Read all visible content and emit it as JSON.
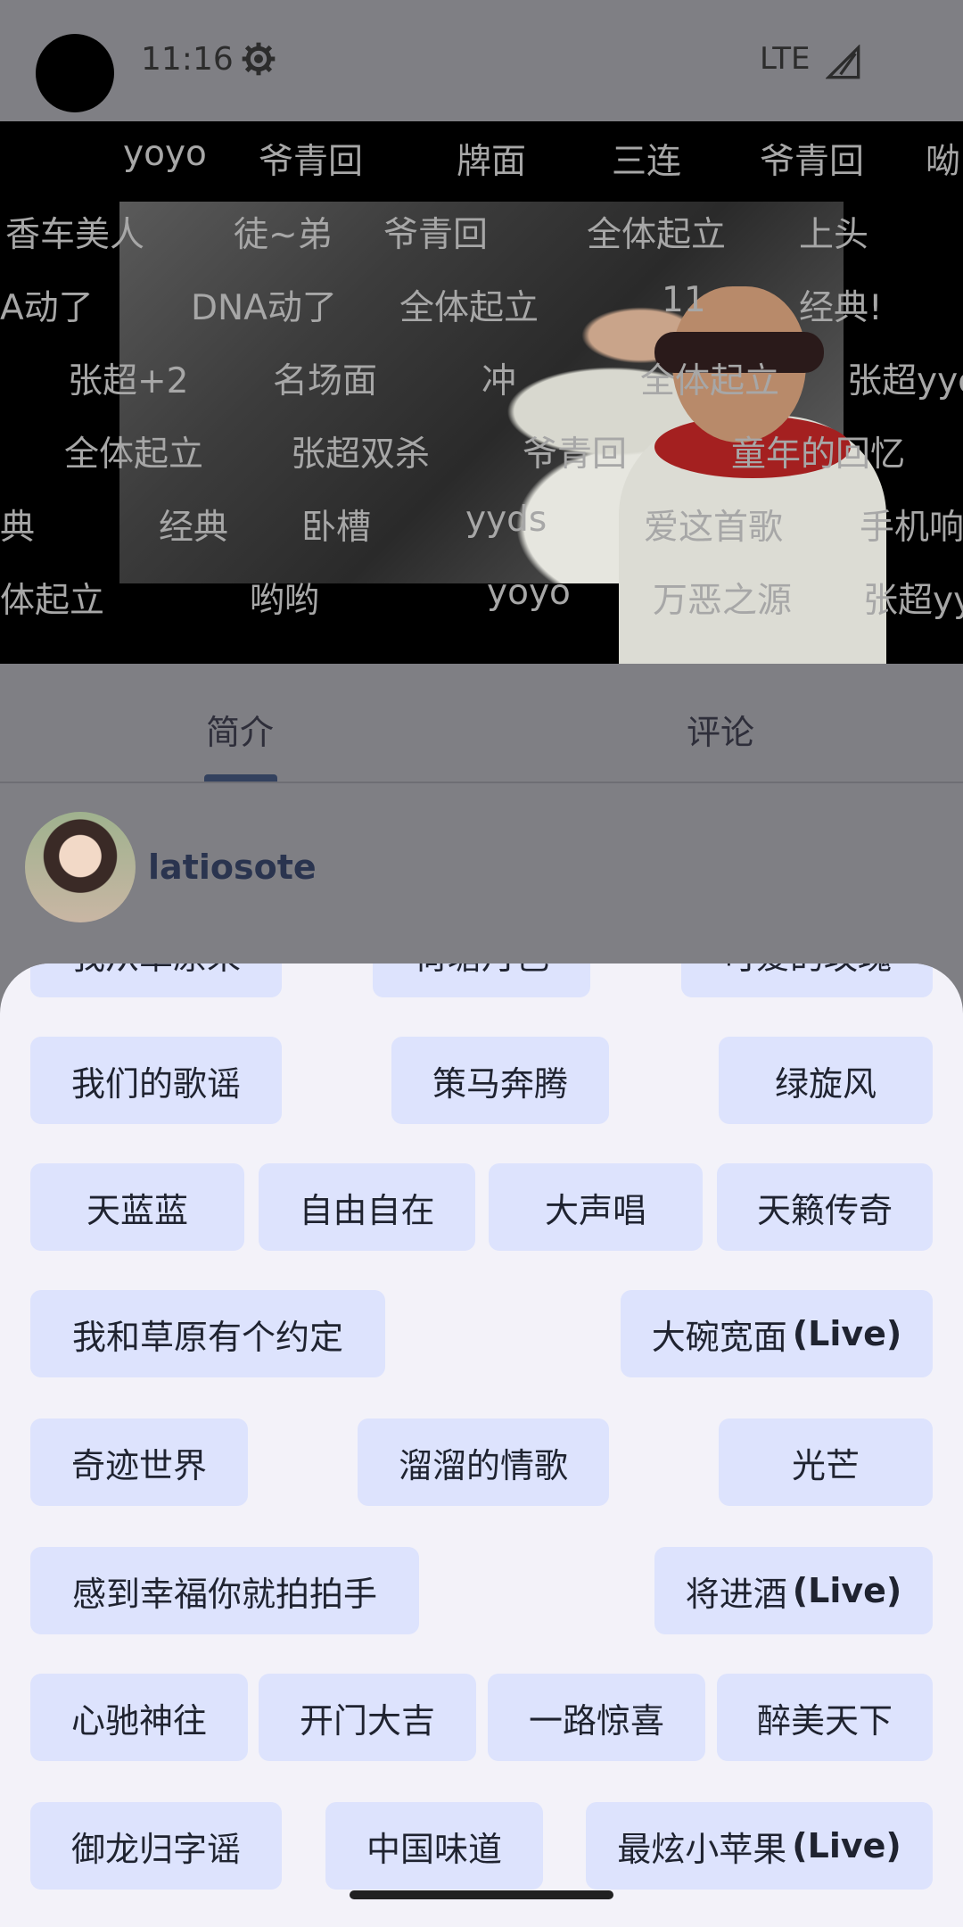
{
  "status": {
    "time": "11:16",
    "network": "LTE"
  },
  "danmaku": [
    "yoyo",
    "爷青回",
    "牌面",
    "三连",
    "爷青回",
    "呦",
    "香车美人",
    "徒~弟",
    "爷青回",
    "全体起立",
    "上头",
    "A动了",
    "DNA动了",
    "全体起立",
    "11",
    "经典!",
    "张超+2",
    "名场面",
    "冲",
    "全体起立",
    "张超yyc",
    "全体起立",
    "张超双杀",
    "爷青回",
    "童年的回忆",
    "典",
    "经典",
    "卧槽",
    "yyds",
    "爱这首歌",
    "手机响",
    "体起立",
    "哟哟",
    "yoyo",
    "万恶之源",
    "张超yy"
  ],
  "tabs": {
    "intro": "简介",
    "comments": "评论"
  },
  "uploader": {
    "name": "latiosote"
  },
  "songs_partial": [
    "我从草原来",
    "荷塘月色",
    "可爱的玫瑰"
  ],
  "songs": [
    {
      "title": "我们的歌谣",
      "suffix": ""
    },
    {
      "title": "策马奔腾",
      "suffix": ""
    },
    {
      "title": "绿旋风",
      "suffix": ""
    },
    {
      "title": "天蓝蓝",
      "suffix": ""
    },
    {
      "title": "自由自在",
      "suffix": ""
    },
    {
      "title": "大声唱",
      "suffix": ""
    },
    {
      "title": "天籁传奇",
      "suffix": ""
    },
    {
      "title": "我和草原有个约定",
      "suffix": ""
    },
    {
      "title": "大碗宽面",
      "suffix": "(Live)"
    },
    {
      "title": "奇迹世界",
      "suffix": ""
    },
    {
      "title": "溜溜的情歌",
      "suffix": ""
    },
    {
      "title": "光芒",
      "suffix": ""
    },
    {
      "title": "感到幸福你就拍拍手",
      "suffix": ""
    },
    {
      "title": "将进酒",
      "suffix": "(Live)"
    },
    {
      "title": "心驰神往",
      "suffix": ""
    },
    {
      "title": "开门大吉",
      "suffix": ""
    },
    {
      "title": "一路惊喜",
      "suffix": ""
    },
    {
      "title": "醉美天下",
      "suffix": ""
    },
    {
      "title": "御龙归字谣",
      "suffix": ""
    },
    {
      "title": "中国味道",
      "suffix": ""
    },
    {
      "title": "最炫小苹果",
      "suffix": "(Live)"
    }
  ]
}
